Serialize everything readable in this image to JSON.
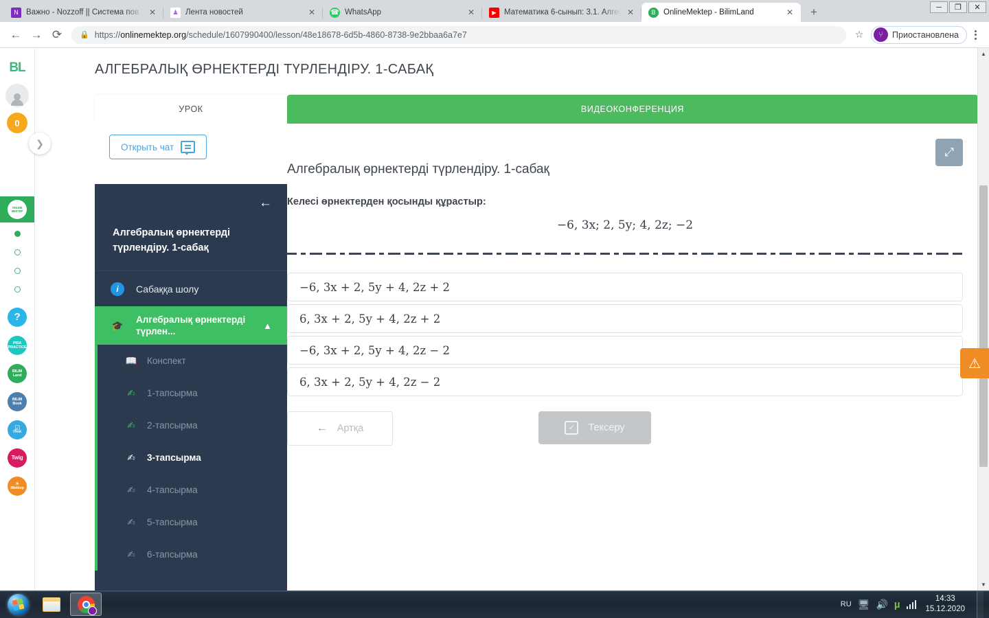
{
  "browser": {
    "tabs": [
      {
        "title": "Важно - Nozzoff || Система пов",
        "favicon_name": "nozzoff-icon",
        "favicon_color": "#7b2fbe",
        "favicon_glyph": "N",
        "active": false
      },
      {
        "title": "Лента новостей",
        "favicon_name": "news-feed-icon",
        "favicon_color": "#ffffff",
        "favicon_glyph": "♟",
        "active": false
      },
      {
        "title": "WhatsApp",
        "favicon_name": "whatsapp-icon",
        "favicon_color": "#25d366",
        "favicon_glyph": "✆",
        "active": false
      },
      {
        "title": "Математика 6-сынып: 3.1. Алгеб",
        "favicon_name": "youtube-icon",
        "favicon_color": "#ff0000",
        "favicon_glyph": "▶",
        "active": false
      },
      {
        "title": "OnlineMektep - BilimLand",
        "favicon_name": "onlinemektep-icon",
        "favicon_color": "#2fad5b",
        "favicon_glyph": "B",
        "active": true
      }
    ],
    "close_label": "✕",
    "new_tab_label": "+",
    "window_controls": [
      "─",
      "❐",
      "✕"
    ],
    "back_icon": "←",
    "forward_icon": "→",
    "reload_icon": "⟳",
    "lock_icon": "🔒",
    "url_scheme": "https://",
    "url_host": "onlinemektep.org",
    "url_path": "/schedule/1607990400/lesson/48e18678-6d5b-4860-8738-9e2bbaa6a7e7",
    "star_icon": "☆",
    "profile_label": "Приостановлена",
    "profile_initial": "⑂"
  },
  "rail": {
    "logo": "BL",
    "coin_count": "0",
    "tile_line1": "ONLINE",
    "tile_line2": "MEKTEP",
    "dots": [
      "on",
      "off",
      "off",
      "off"
    ],
    "apps": [
      {
        "name": "help-icon",
        "label": "?",
        "color": "#29b6e8",
        "type": "glyph"
      },
      {
        "name": "pisa-icon",
        "label1": "PISA",
        "label2": "PRACTICE",
        "color": "#1ec8c0"
      },
      {
        "name": "bilimland-icon",
        "label1": "BILIM",
        "label2": "Land",
        "color": "#2fad5b"
      },
      {
        "name": "bilimbook-icon",
        "label1": "BILIM",
        "label2": "Book",
        "color": "#4b7fae"
      },
      {
        "name": "itest-icon",
        "label1": "☑",
        "label2": "iTest",
        "color": "#36a9e1"
      },
      {
        "name": "twig-icon",
        "label1": "Twig",
        "label2": "",
        "color": "#d81b60"
      },
      {
        "name": "imektep-icon",
        "label1": "☀",
        "label2": "iMektep",
        "color": "#f08c24"
      }
    ],
    "expand_icon": "❯"
  },
  "page": {
    "title": "АЛГЕБРАЛЫҚ ӨРНЕКТЕРДІ ТҮРЛЕНДІРУ. 1-САБАҚ",
    "tabs": {
      "lesson": "УРОК",
      "videoconference": "ВИДЕОКОНФЕРЕНЦИЯ"
    },
    "chat_button": "Открыть чат",
    "expand_icon": "⤢",
    "warning_icon": "⚠"
  },
  "sidebar": {
    "back_icon": "←",
    "lesson_title": "Алгебралық өрнектерді түрлендіру. 1-сабақ",
    "overview": {
      "label": "Сабаққа шолу",
      "icon": "info-icon"
    },
    "active_section": {
      "label": "Алгебралық өрнектерді түрлен...",
      "icon": "graduation-cap-icon",
      "chevron": "⌃"
    },
    "items": [
      {
        "label": "Конспект",
        "icon": "book-icon",
        "state": "normal"
      },
      {
        "label": "1-тапсырма",
        "icon": "task-icon",
        "state": "normal"
      },
      {
        "label": "2-тапсырма",
        "icon": "task-icon",
        "state": "normal"
      },
      {
        "label": "3-тапсырма",
        "icon": "task-icon",
        "state": "current"
      },
      {
        "label": "4-тапсырма",
        "icon": "task-icon",
        "state": "normal"
      },
      {
        "label": "5-тапсырма",
        "icon": "task-icon",
        "state": "normal"
      },
      {
        "label": "6-тапсырма",
        "icon": "task-icon",
        "state": "normal"
      }
    ]
  },
  "lesson": {
    "heading": "Алгебралық өрнектерді түрлендіру. 1-сабақ",
    "prompt": "Келесі өрнектерден қосынды құрастыр:",
    "expression": "−6, 3x;  2, 5y;  4, 2z;  −2",
    "options": [
      "−6, 3x + 2, 5y + 4, 2z + 2",
      "6, 3x + 2, 5y + 4, 2z + 2",
      "−6, 3x + 2, 5y + 4, 2z − 2",
      "6, 3x + 2, 5y + 4, 2z − 2"
    ],
    "back_button": "Артқа",
    "back_icon": "←",
    "check_button": "Тексеру",
    "check_icon": "✓"
  },
  "taskbar": {
    "start_label": "Start",
    "items": [
      {
        "name": "file-explorer",
        "label": "Windows Explorer"
      },
      {
        "name": "google-chrome",
        "label": "Google Chrome"
      }
    ],
    "tray": {
      "language": "RU",
      "network_icon": "network-icon",
      "volume_icon": "🔊",
      "utorrent_icon": "µ",
      "signal_icon": "signal-bars-icon",
      "time": "14:33",
      "date": "15.12.2020"
    }
  },
  "colors": {
    "green": "#4cbb5f",
    "active_green": "#3fbf63",
    "navy": "#2b3a4e",
    "blue": "#49a4e0",
    "orange": "#f08c24",
    "amber": "#f7a91d"
  }
}
